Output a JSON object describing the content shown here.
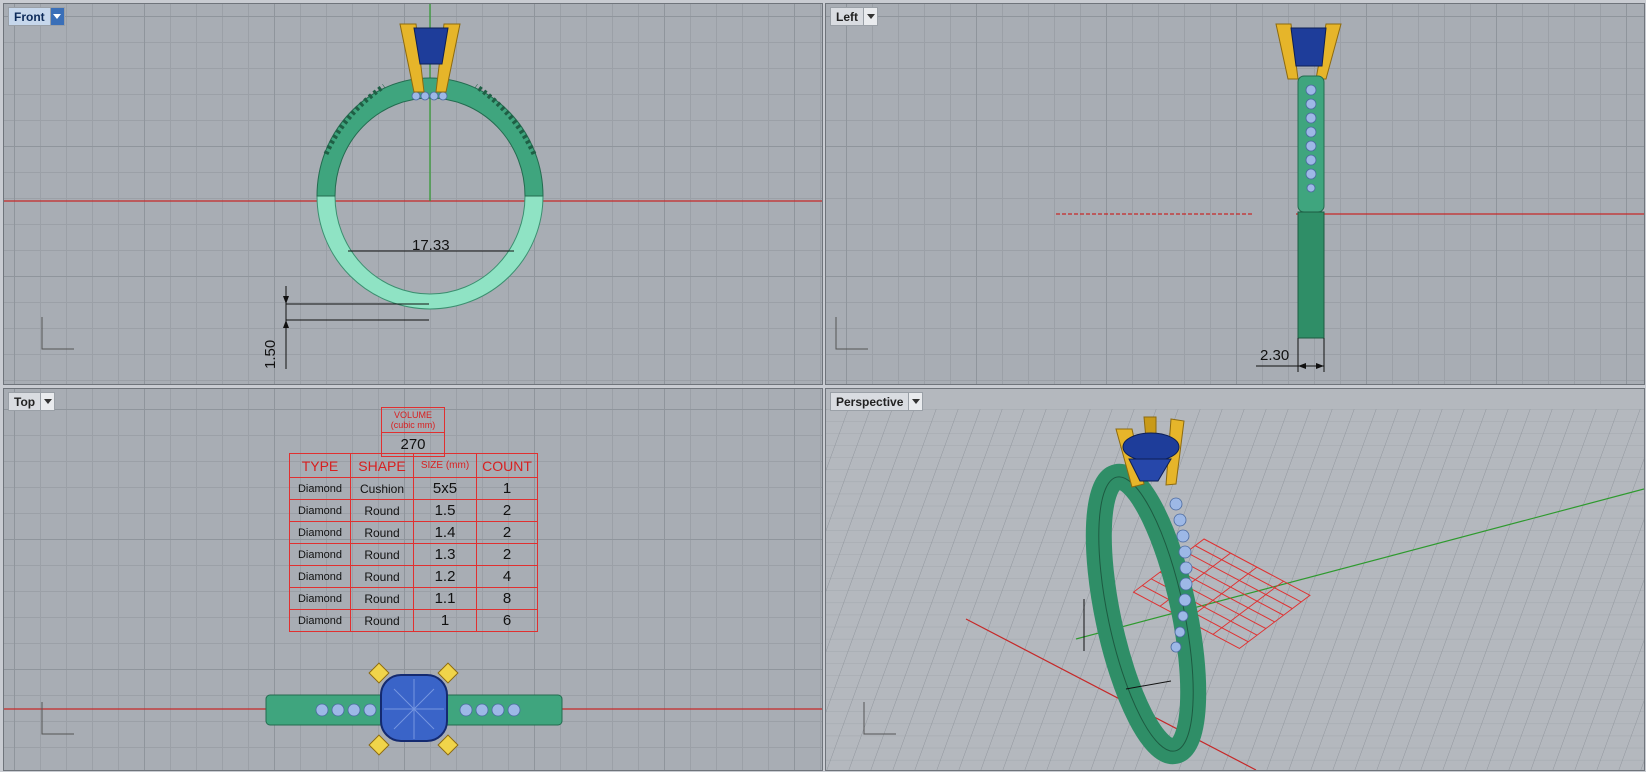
{
  "viewports": {
    "front": {
      "label": "Front"
    },
    "left": {
      "label": "Left"
    },
    "top": {
      "label": "Top"
    },
    "perspective": {
      "label": "Perspective"
    }
  },
  "dimensions": {
    "inner_diameter": "17.33",
    "band_thickness": "1.50",
    "band_width": "2.30"
  },
  "volume": {
    "label_line1": "VOLUME",
    "label_line2": "(cubic mm)",
    "value": "270"
  },
  "stone_table": {
    "headers": [
      "TYPE",
      "SHAPE",
      "SIZE (mm)",
      "COUNT"
    ],
    "rows": [
      [
        "Diamond",
        "Cushion",
        "5x5",
        "1"
      ],
      [
        "Diamond",
        "Round",
        "1.5",
        "2"
      ],
      [
        "Diamond",
        "Round",
        "1.4",
        "2"
      ],
      [
        "Diamond",
        "Round",
        "1.3",
        "2"
      ],
      [
        "Diamond",
        "Round",
        "1.2",
        "4"
      ],
      [
        "Diamond",
        "Round",
        "1.1",
        "8"
      ],
      [
        "Diamond",
        "Round",
        "1",
        "6"
      ]
    ]
  },
  "colors": {
    "band": "#3fa57e",
    "band_light": "#8fe3c4",
    "prongs": "#e6b52a",
    "center_stone": "#1e3d9a",
    "small_stones": "#9db8e6",
    "x_axis": "#c62828",
    "y_axis": "#2e9a2e",
    "annotation": "#e03030",
    "active_tab": "#3a6fb8"
  }
}
